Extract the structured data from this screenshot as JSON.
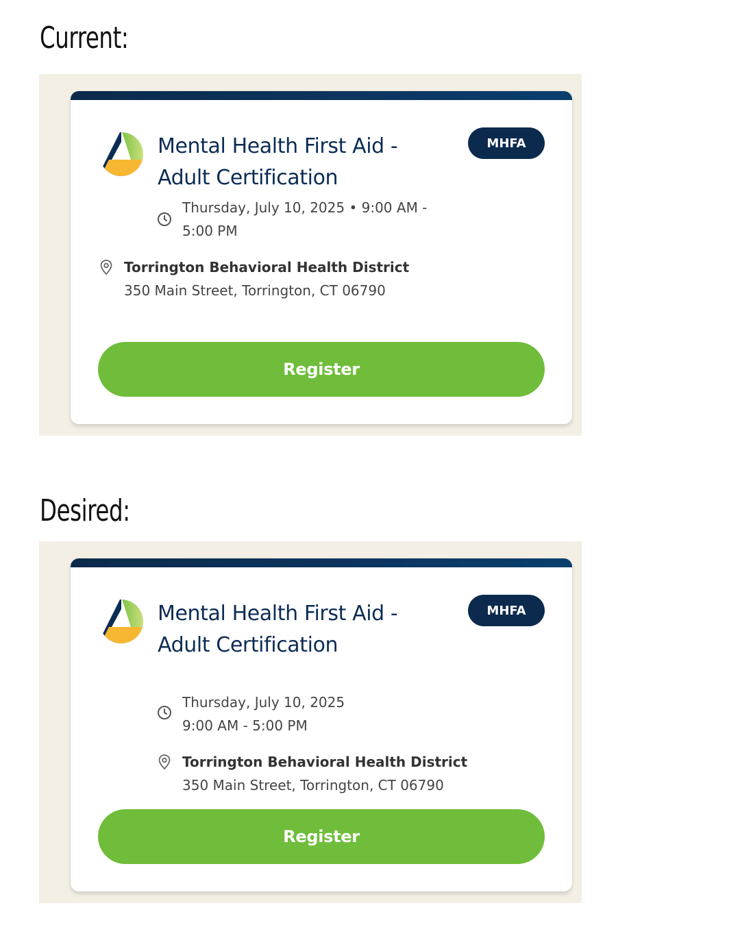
{
  "labels": {
    "current": "Current:",
    "desired": "Desired:"
  },
  "event": {
    "title": "Mental Health First Aid - Adult Certification",
    "badge": "MHFA",
    "date": "Thursday, July 10, 2025",
    "time": "9:00 AM - 5:00 PM",
    "datetime_combined": "Thursday, July 10, 2025 • 9:00 AM - 5:00 PM",
    "location_name": "Torrington Behavioral Health District",
    "location_address": "350 Main Street, Torrington, CT 06790",
    "register_label": "Register"
  },
  "colors": {
    "panel_background": "#f3efe5",
    "card_background": "#ffffff",
    "top_bar": "#0c3560",
    "title": "#0c2c54",
    "badge": "#0c2a4d",
    "register_button": "#6fbd3a"
  },
  "icons": {
    "logo": "mhfa-logo",
    "time": "clock-icon",
    "location": "location-pin-icon"
  }
}
